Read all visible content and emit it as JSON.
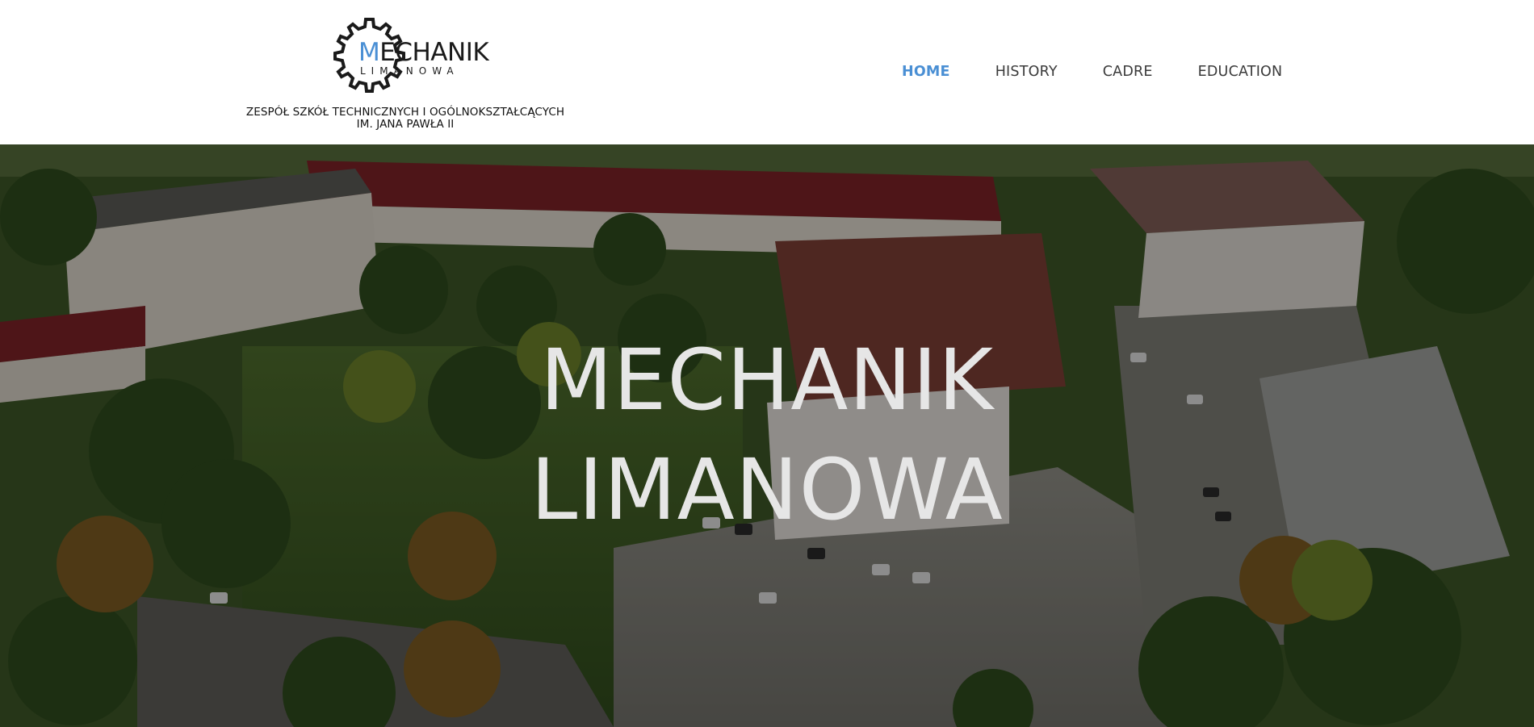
{
  "brand": {
    "word_initial": "M",
    "word_rest": "ECHANIK",
    "sub": "LIMANOWA",
    "school_line1": "ZESPÓŁ SZKÓŁ TECHNICZNYCH I OGÓLNOKSZTAŁCĄCYCH",
    "school_line2": "IM. JANA PAWŁA II",
    "accent_color": "#4a8fd4"
  },
  "nav": {
    "items": [
      {
        "label": "HOME",
        "active": true
      },
      {
        "label": "HISTORY",
        "active": false
      },
      {
        "label": "CADRE",
        "active": false
      },
      {
        "label": "EDUCATION",
        "active": false
      }
    ]
  },
  "hero": {
    "title_line1": "MECHANIK",
    "title_line2": "LIMANOWA",
    "background": "aerial photo of school campus buildings with red roofs surrounded by trees"
  }
}
